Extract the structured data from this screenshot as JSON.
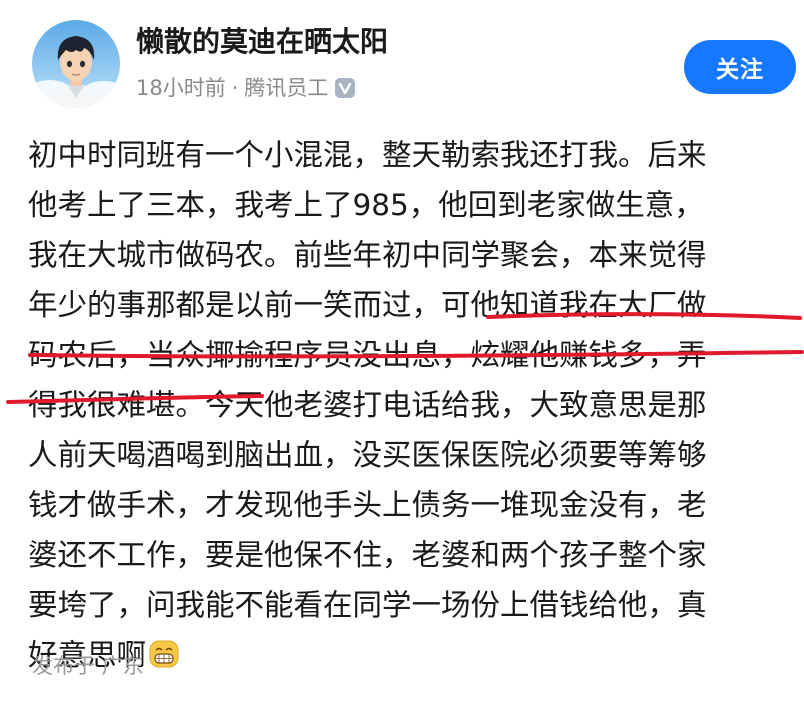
{
  "author": {
    "name": "懒散的莫迪在晒太阳",
    "time": "18小时前",
    "separator": "·",
    "affiliation": "腾讯员工",
    "avatar_icon": "anime-boy-avatar",
    "verified_icon": "verified-v-badge"
  },
  "follow_button": {
    "label": "关注",
    "color": "#1677ff"
  },
  "post": {
    "lines": [
      "初中时同班有一个小混混，整天勒索我还打我。后来",
      "他考上了三本，我考上了985，他回到老家做生意，",
      "我在大城市做码农。前些年初中同学聚会，本来觉得",
      "年少的事那都是以前一笑而过，可他知道我在大厂做",
      "码农后，当众揶揄程序员没出息，炫耀他赚钱多，弄",
      "得我很难堪。今天他老婆打电话给我，大致意思是那",
      "人前天喝酒喝到脑出血，没买医保医院必须要等筹够",
      "钱才做手术，才发现他手头上债务一堆现金没有，老",
      "婆还不工作，要是他保不住，老婆和两个孩子整个家",
      "要垮了，问我能不能看在同学一场份上借钱给他，真",
      "好意思啊"
    ],
    "emoji_icon": "grinning-face-emoji",
    "annotation_color": "#e0192d"
  },
  "location": {
    "label": "发布于 广东"
  }
}
